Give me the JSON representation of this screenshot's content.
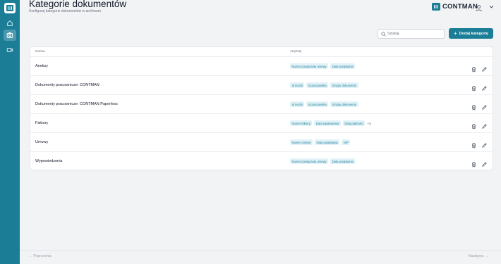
{
  "sidebar": {
    "items": [
      {
        "icon": "home-icon"
      },
      {
        "icon": "folder-camera-icon",
        "active": true
      },
      {
        "icon": "video-camera-icon"
      }
    ]
  },
  "header": {
    "title": "Kategorie dokumentów",
    "subtitle": "Konfiguruj kategorie dokumentów w archiwum",
    "brand": "CONTMAN"
  },
  "toolbar": {
    "search_placeholder": "Szukaj",
    "add_label": "Dodaj kategorię"
  },
  "table": {
    "columns": [
      "Nazwa",
      "Atrybuty"
    ],
    "rows": [
      {
        "name": "Aneksy",
        "tags": [
          "Numer powiązanej umowy",
          "Data podpisania"
        ],
        "more": ""
      },
      {
        "name": "Dokumenty pracownicze: CONTMAN",
        "tags": [
          "Id teczki",
          "Id pracownika",
          "Id typu dokumentu"
        ],
        "more": ""
      },
      {
        "name": "Dokumenty pracownicze: CONTMAN Paperless",
        "tags": [
          "Id teczki",
          "Id pracownika",
          "Id typu dokumentu"
        ],
        "more": ""
      },
      {
        "name": "Faktury",
        "tags": [
          "Numer faktury",
          "Data wystawienia",
          "Data płatności"
        ],
        "more": "+3"
      },
      {
        "name": "Umowy",
        "tags": [
          "Numer umowy",
          "Data podpisania",
          "NIP"
        ],
        "more": ""
      },
      {
        "name": "Wypowiedzenia",
        "tags": [
          "Numer powiązanej umowy",
          "Data podpisania"
        ],
        "more": ""
      }
    ]
  },
  "pagination": {
    "prev": "← Poprzednia",
    "next": "Następna →"
  },
  "colors": {
    "accent": "#1c7d96",
    "tag_bg": "#e0f2f7",
    "background": "#f1f3f5"
  }
}
